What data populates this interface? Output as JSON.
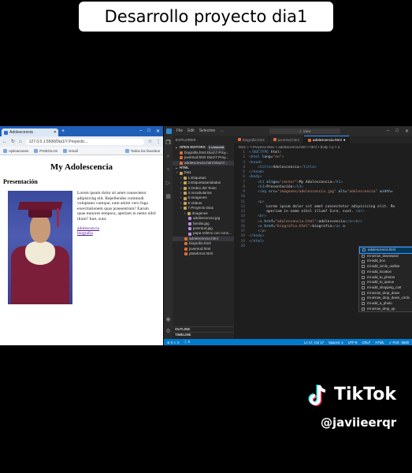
{
  "caption": "Desarrollo proyecto dia1",
  "browser": {
    "tab_title": "Adolescencia",
    "url": "127.0.0.1:5500/Dia1/7.Proyecto...",
    "bookmarks": [
      "Aplicaciones",
      "PIGEOLAS",
      "Gmail"
    ],
    "bookmarks_right": "Todos los favoritos",
    "page_title": "My Adolescencia",
    "section_heading": "Presentación",
    "paragraph": "Lorem ipsum dolor sit amet consectetur adipisicing elit. Repellendus commodi voluptates cumque, eum animi vero fuga exercitationem quas praesentium? Earum quae maiores tempora, aperiam in nemo nihil illum? Iure, sunt.",
    "links": [
      "adolescencia",
      "biografia"
    ]
  },
  "vscode": {
    "menu": [
      "File",
      "Edit",
      "Selection",
      "…"
    ],
    "search": "View",
    "explorer_header": "EXPLORER",
    "open_editors": {
      "label": "OPEN EDITORS",
      "badge": "1 unsaved"
    },
    "open_editor_items": [
      "biografia.html Dia1\\7.Proy...",
      "juventud.html Dia1\\7.Proy...",
      "adolescencia.html Dia1\\7..."
    ],
    "workspace": "HTML",
    "tree": [
      {
        "label": "Dia1",
        "kind": "folder",
        "indent": 1
      },
      {
        "label": "1.Etiquetas",
        "kind": "folder",
        "indent": 2
      },
      {
        "label": "2.Etiquetasanidadas",
        "kind": "folder",
        "indent": 2
      },
      {
        "label": "3.Orden del Texto",
        "kind": "folder",
        "indent": 2
      },
      {
        "label": "4.Vocabularios",
        "kind": "folder",
        "indent": 2
      },
      {
        "label": "5.Imagenes",
        "kind": "folder",
        "indent": 2
      },
      {
        "label": "6.Videos",
        "kind": "folder",
        "indent": 2
      },
      {
        "label": "7.Proyecto Dia1",
        "kind": "folder",
        "indent": 2
      },
      {
        "label": "Imagenes",
        "kind": "folder",
        "indent": 3
      },
      {
        "label": "adolescencia.jpg",
        "kind": "img",
        "indent": 4
      },
      {
        "label": "familia.jpg",
        "kind": "img",
        "indent": 4
      },
      {
        "label": "juventud.jpg",
        "kind": "img",
        "indent": 4
      },
      {
        "label": "papa relleno con cons...",
        "kind": "img",
        "indent": 4
      },
      {
        "label": "adolescencia.html",
        "kind": "html",
        "indent": 3,
        "selected": true
      },
      {
        "label": "biografia.html",
        "kind": "html",
        "indent": 3
      },
      {
        "label": "juventud.html",
        "kind": "html",
        "indent": 3
      },
      {
        "label": "plataforos.html",
        "kind": "html",
        "indent": 3
      }
    ],
    "outline": "OUTLINE",
    "timeline": "TIMELINE",
    "tabs": [
      "biografia.html",
      "juventud.html",
      "adolescencia.html"
    ],
    "breadcrumb": "Dia1 > 7.Proyecto Dia1 > adolescencia.html > html > body > p > a",
    "code_lines": [
      "<!DOCTYPE html>",
      "<html lang=\"en\">",
      "<head>",
      "    <title>Adolescencia</title>",
      "</head>",
      "<body>",
      "    <h1 align=\"center\">My Adolescencia</h1>",
      "    <h3>Presentación</h3>",
      "    <img src=\"imagenes/adolescencia.jpg\" alt=\"adolescencia\" width=\"",
      "",
      "    <p>",
      "        Lorem ipsum dolor sit amet consectetur adipisicing elit. Re",
      "        aperiam in nemo nihil illum? Iure, sunt. <br>",
      "    <br>",
      "    <a href=\"adolescencia.html\">adolescencia</a><br>",
      "    <a href=\"biografia.html\">biografia</a> a",
      "    </p>",
      "</body>",
      "</html>",
      ""
    ],
    "suggestions": [
      {
        "label": "adolescencia.html",
        "detail": ""
      },
      {
        "label": "mi-arrow_downward",
        "detail": "arrow_downward"
      },
      {
        "label": "mi-add_box",
        "detail": "add_box"
      },
      {
        "label": "mi-add_circle_outline",
        "detail": "add_circle_outline"
      },
      {
        "label": "mi-add_location",
        "detail": "add_location"
      },
      {
        "label": "mi-add_to_photos",
        "detail": "add_to_photos"
      },
      {
        "label": "mi-add_to_queue",
        "detail": "add_to_queue"
      },
      {
        "label": "mi-add_shopping_cart",
        "detail": "add_shopping_cart"
      },
      {
        "label": "mi-arrow_drop_down",
        "detail": "arrow_drop_down"
      },
      {
        "label": "mi-arrow_drop_down_circle",
        "detail": "arrow_drop_down_circle"
      },
      {
        "label": "mi-add_a_photo",
        "detail": "add_a_photo"
      },
      {
        "label": "mi-arrow_drop_up",
        "detail": "arrow_drop_up"
      }
    ],
    "status_left": [
      "⊗ 0 ⚠ 0",
      "ⓘ 0"
    ],
    "status_right": [
      "Ln 17, Col 17",
      "Spaces: 4",
      "UTF-8",
      "CRLF",
      "HTML",
      "✔ Port : 5500"
    ]
  },
  "watermark": {
    "brand": "TikTok",
    "user": "@javiieerqr"
  },
  "colors": {
    "vscode_status": "#007acc",
    "browser_chrome": "#1f5fb8"
  }
}
